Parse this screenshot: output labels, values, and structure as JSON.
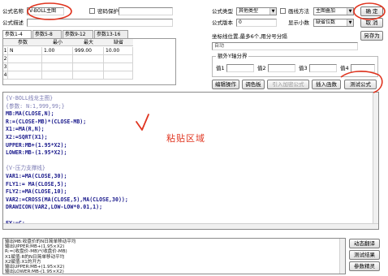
{
  "form": {
    "name_label": "公式名称",
    "name_value": "V-BOLL主图",
    "password_label": "密码保护",
    "desc_label": "公式描述",
    "desc_value": "",
    "type_label": "公式类型",
    "type_value": "其他类型",
    "draw_label": "画线方法",
    "draw_value": "主图叠加",
    "version_label": "公式版本",
    "version_value": "0",
    "decimals_label": "显示小数",
    "decimals_value": "缺省位数",
    "ok_label": "确 定",
    "cancel_label": "取 消",
    "saveas_label": "另存为"
  },
  "params": {
    "tabs": [
      "参数1-4",
      "参数5-8",
      "参数9-12",
      "参数13-16"
    ],
    "headers": [
      "参数",
      "最小",
      "最大",
      "缺省"
    ],
    "rows": [
      {
        "idx": "1",
        "name": "N",
        "min": "1.00",
        "max": "999.00",
        "def": "10.00"
      },
      {
        "idx": "2",
        "name": "",
        "min": "",
        "max": "",
        "def": ""
      },
      {
        "idx": "3",
        "name": "",
        "min": "",
        "max": "",
        "def": ""
      },
      {
        "idx": "4",
        "name": "",
        "min": "",
        "max": "",
        "def": ""
      }
    ]
  },
  "axis": {
    "coord_label": "坐标线位置,最多6个,用分号分隔",
    "coord_value": "自动",
    "group_label": "额外Y轴分界",
    "v1_label": "值1",
    "v2_label": "值2",
    "v3_label": "值3",
    "v4_label": "值4"
  },
  "toolbar": {
    "edit_label": "编辑操作",
    "palette_label": "调色板",
    "import_label": "引入加密公式",
    "insert_func_label": "插入函数",
    "test_label": "测试公式"
  },
  "editor": {
    "lines": [
      {
        "text": "{V-BOLL线龙主图}",
        "style": "comment"
      },
      {
        "text": "{参数: N:1,999,99;}",
        "style": "comment"
      },
      {
        "text": "MB:MA(CLOSE,N);",
        "style": "code"
      },
      {
        "text": "R:=(CLOSE-MB)*(CLOSE-MB);",
        "style": "code"
      },
      {
        "text": "X1:=MA(R,N);",
        "style": "code"
      },
      {
        "text": "X2:=SQRT(X1);",
        "style": "code"
      },
      {
        "text": "UPPER:MB+(1.95*X2);",
        "style": "code"
      },
      {
        "text": "LOWER:MB-(1.95*X2);",
        "style": "code"
      },
      {
        "text": "",
        "style": "code"
      },
      {
        "text": "{V-压力支撑线}",
        "style": "comment"
      },
      {
        "text": "VAR1:=MA(CLOSE,30);",
        "style": "code"
      },
      {
        "text": "FLY1:= MA(CLOSE,5);",
        "style": "code"
      },
      {
        "text": "FLY2:=MA(CLOSE,10);",
        "style": "code"
      },
      {
        "text": "VAR2:=CROSS(MA(CLOSE,5),MA(CLOSE,30));",
        "style": "code"
      },
      {
        "text": "DRAWICON(VAR2,LOW-LOW*0.01,1);",
        "style": "code"
      },
      {
        "text": "",
        "style": "code"
      },
      {
        "text": "FY:=C;",
        "style": "code"
      }
    ],
    "annotation": "粘贴区域"
  },
  "output": {
    "lines": [
      "输出MB:收盘价的N日简单移动平均",
      "输出UPPER:MB+(1.95×X2)",
      "R:=(收盘价-MB)*(收盘价-MB)",
      "X1赋值:R的N日简单移动平均",
      "X2赋值:X1的开方",
      "输出UPPER:MB+(1.95×X2)",
      "输出LOWER:MB-(1.95×X2)"
    ],
    "btn_translate": "动态翻译",
    "btn_test_result": "测试结果",
    "btn_param_guide": "参数精灵"
  },
  "colors": {
    "annotation_red": "#e0341f",
    "code_blue": "#1a1a8c",
    "comment_purple": "#7b7bb4"
  }
}
